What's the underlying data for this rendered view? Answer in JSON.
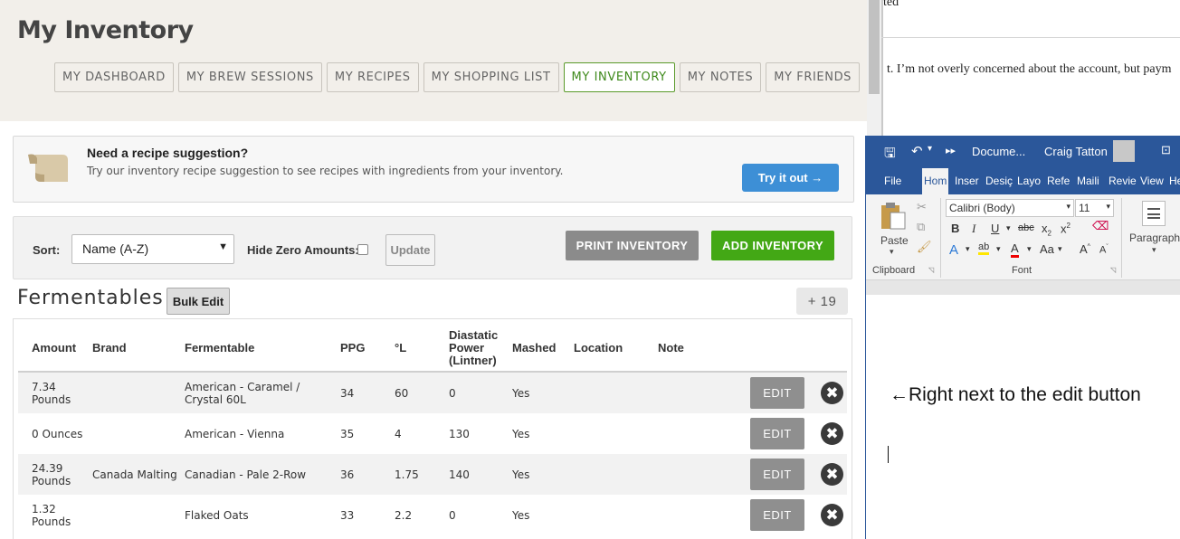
{
  "page": {
    "title": "My Inventory",
    "tabs": [
      {
        "label": "MY DASHBOARD",
        "active": false
      },
      {
        "label": "MY BREW SESSIONS",
        "active": false
      },
      {
        "label": "MY RECIPES",
        "active": false
      },
      {
        "label": "MY SHOPPING LIST",
        "active": false
      },
      {
        "label": "MY INVENTORY",
        "active": true
      },
      {
        "label": "MY NOTES",
        "active": false
      },
      {
        "label": "MY FRIENDS",
        "active": false
      }
    ]
  },
  "suggestion": {
    "title": "Need a recipe suggestion?",
    "text": "Try our inventory recipe suggestion to see recipes with ingredients from your inventory.",
    "button": "Try it out →"
  },
  "toolbar": {
    "sort_label": "Sort:",
    "sort_value": "Name (A-Z)",
    "hide_zero_label": "Hide Zero Amounts:",
    "update_label": "Update",
    "print_label": "PRINT INVENTORY",
    "add_label": "ADD INVENTORY"
  },
  "fermentables": {
    "title": "Fermentables",
    "bulk_edit": "Bulk Edit",
    "count": "+ 19",
    "headers": [
      "Amount",
      "Brand",
      "Fermentable",
      "PPG",
      "°L",
      "Diastatic Power (Lintner)",
      "Mashed",
      "Location",
      "Note"
    ],
    "rows": [
      {
        "amount": "7.34 Pounds",
        "brand": "",
        "fermentable": "American - Caramel / Crystal 60L",
        "ppg": "34",
        "lovibond": "60",
        "diastatic": "0",
        "mashed": "Yes",
        "location": "",
        "note": ""
      },
      {
        "amount": "0 Ounces",
        "brand": "",
        "fermentable": "American - Vienna",
        "ppg": "35",
        "lovibond": "4",
        "diastatic": "130",
        "mashed": "Yes",
        "location": "",
        "note": ""
      },
      {
        "amount": "24.39 Pounds",
        "brand": "Canada Malting",
        "fermentable": "Canadian - Pale 2-Row",
        "ppg": "36",
        "lovibond": "1.75",
        "diastatic": "140",
        "mashed": "Yes",
        "location": "",
        "note": ""
      },
      {
        "amount": "1.32 Pounds",
        "brand": "",
        "fermentable": "Flaked Oats",
        "ppg": "33",
        "lovibond": "2.2",
        "diastatic": "0",
        "mashed": "Yes",
        "location": "",
        "note": ""
      }
    ],
    "edit_label": "EDIT",
    "delete_glyph": "✖"
  },
  "doc_background": {
    "line1": "ted",
    "line2": "t.  I’m not overly concerned about the account, but paym"
  },
  "word": {
    "doc_name": "Docume...",
    "user": "Craig Tatton",
    "tabs": [
      "File",
      "Hom",
      "Inser",
      "Desiç",
      "Layo",
      "Refe",
      "Maili",
      "Revie",
      "View",
      "He"
    ],
    "font_name": "Calibri (Body)",
    "font_size": "11",
    "paste_label": "Paste",
    "clipboard_label": "Clipboard",
    "font_label": "Font",
    "paragraph_label": "Paragraph",
    "annotation": "←Right next to the edit button",
    "accent": "#2b579a"
  }
}
